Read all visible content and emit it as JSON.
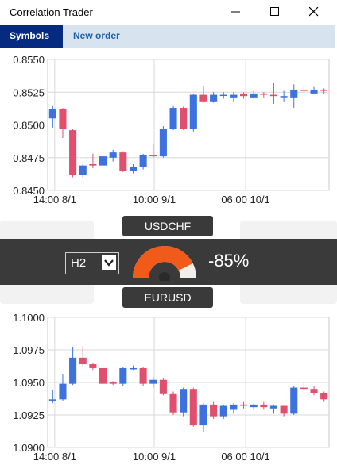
{
  "window": {
    "title": "Correlation Trader",
    "icons": {
      "minimize": "minimize-icon",
      "maximize": "maximize-icon",
      "close": "close-icon"
    }
  },
  "tabs": [
    {
      "label": "Symbols",
      "active": true
    },
    {
      "label": "New order",
      "active": false
    }
  ],
  "center_panel": {
    "symbol_top": "USDCHF",
    "symbol_bottom": "EURUSD",
    "timeframe": "H2",
    "correlation": "-85%",
    "correlation_value": -0.85
  },
  "colors": {
    "bull": "#3d72de",
    "bear": "#e0506e",
    "gauge_fill": "#f05a1a",
    "gauge_track": "#f2efe9",
    "band": "#3a3a3a",
    "active_tab": "#062a80"
  },
  "chart_data": [
    {
      "type": "candlestick",
      "symbol": "USDCHF",
      "ylim": [
        0.845,
        0.855
      ],
      "y_ticks": [
        "0.8550",
        "0.8525",
        "0.8500",
        "0.8475",
        "0.8450"
      ],
      "x_ticks": [
        "14:00 8/1",
        "10:00 9/1",
        "06:00 10/1"
      ],
      "grid": true,
      "candles": [
        [
          0.8505,
          0.8512,
          0.8498,
          0.8515
        ],
        [
          0.8512,
          0.8497,
          0.849,
          0.8513
        ],
        [
          0.8496,
          0.8462,
          0.846,
          0.8497
        ],
        [
          0.8462,
          0.8469,
          0.846,
          0.847
        ],
        [
          0.847,
          0.8469,
          0.8467,
          0.8478
        ],
        [
          0.8469,
          0.8476,
          0.8468,
          0.8479
        ],
        [
          0.8475,
          0.8479,
          0.8472,
          0.8481
        ],
        [
          0.8479,
          0.8465,
          0.8464,
          0.848
        ],
        [
          0.8465,
          0.8468,
          0.8463,
          0.847
        ],
        [
          0.8468,
          0.8477,
          0.8466,
          0.8478
        ],
        [
          0.8477,
          0.8476,
          0.8475,
          0.8485
        ],
        [
          0.8476,
          0.8497,
          0.8475,
          0.8499
        ],
        [
          0.8497,
          0.8513,
          0.8496,
          0.8515
        ],
        [
          0.8513,
          0.8497,
          0.8496,
          0.8514
        ],
        [
          0.8497,
          0.8523,
          0.8495,
          0.8524
        ],
        [
          0.8523,
          0.8518,
          0.8517,
          0.853
        ],
        [
          0.8518,
          0.8523,
          0.8517,
          0.8525
        ],
        [
          0.8523,
          0.8523,
          0.852,
          0.8525
        ],
        [
          0.8521,
          0.8523,
          0.8518,
          0.8525
        ],
        [
          0.8524,
          0.8522,
          0.852,
          0.8525
        ],
        [
          0.8521,
          0.8524,
          0.852,
          0.8526
        ],
        [
          0.8524,
          0.8523,
          0.8521,
          0.8525
        ],
        [
          0.8523,
          0.8522,
          0.8516,
          0.8532
        ],
        [
          0.8522,
          0.8522,
          0.8518,
          0.8526
        ],
        [
          0.8521,
          0.8527,
          0.8513,
          0.8531
        ],
        [
          0.8527,
          0.8526,
          0.8524,
          0.8529
        ],
        [
          0.8524,
          0.8527,
          0.8524,
          0.8529
        ],
        [
          0.8527,
          0.8526,
          0.8524,
          0.8528
        ]
      ]
    },
    {
      "type": "candlestick",
      "symbol": "EURUSD",
      "ylim": [
        1.09,
        1.1
      ],
      "y_ticks": [
        "1.1000",
        "1.0975",
        "1.0950",
        "1.0925",
        "1.0900"
      ],
      "x_ticks": [
        "14:00 8/1",
        "10:00 9/1",
        "06:00 10/1"
      ],
      "grid": true,
      "candles": [
        [
          1.0936,
          1.0937,
          1.0934,
          1.0944
        ],
        [
          1.0937,
          1.0949,
          1.0936,
          1.0956
        ],
        [
          1.0949,
          1.0969,
          1.0948,
          1.0977
        ],
        [
          1.0969,
          1.0964,
          1.0962,
          1.0978
        ],
        [
          1.0964,
          1.0961,
          1.0959,
          1.0965
        ],
        [
          1.0961,
          1.0949,
          1.0948,
          1.0962
        ],
        [
          1.095,
          1.0949,
          1.0948,
          1.0951
        ],
        [
          1.0949,
          1.0961,
          1.0947,
          1.0962
        ],
        [
          1.0961,
          1.0961,
          1.0959,
          1.0963
        ],
        [
          1.0961,
          1.0949,
          1.0947,
          1.0962
        ],
        [
          1.0949,
          1.0952,
          1.0946,
          1.0954
        ],
        [
          1.0952,
          1.0941,
          1.094,
          1.0953
        ],
        [
          1.0941,
          1.0927,
          1.0925,
          1.0943
        ],
        [
          1.0927,
          1.0945,
          1.0924,
          1.0946
        ],
        [
          1.0945,
          1.0917,
          1.0916,
          1.0946
        ],
        [
          1.0917,
          1.0933,
          1.0912,
          1.0934
        ],
        [
          1.0933,
          1.0924,
          1.0922,
          1.0935
        ],
        [
          1.0924,
          1.0932,
          1.0922,
          1.0933
        ],
        [
          1.0929,
          1.0933,
          1.0926,
          1.0934
        ],
        [
          1.0933,
          1.0932,
          1.093,
          1.0935
        ],
        [
          1.0931,
          1.0933,
          1.0929,
          1.0934
        ],
        [
          1.0933,
          1.0931,
          1.0929,
          1.0935
        ],
        [
          1.093,
          1.0932,
          1.0926,
          1.0933
        ],
        [
          1.0932,
          1.0926,
          1.0924,
          1.0932
        ],
        [
          1.0926,
          1.0946,
          1.0925,
          1.0947
        ],
        [
          1.0946,
          1.0945,
          1.0942,
          1.095
        ],
        [
          1.0945,
          1.0942,
          1.094,
          1.0947
        ],
        [
          1.0942,
          1.0937,
          1.0935,
          1.0943
        ]
      ]
    }
  ]
}
